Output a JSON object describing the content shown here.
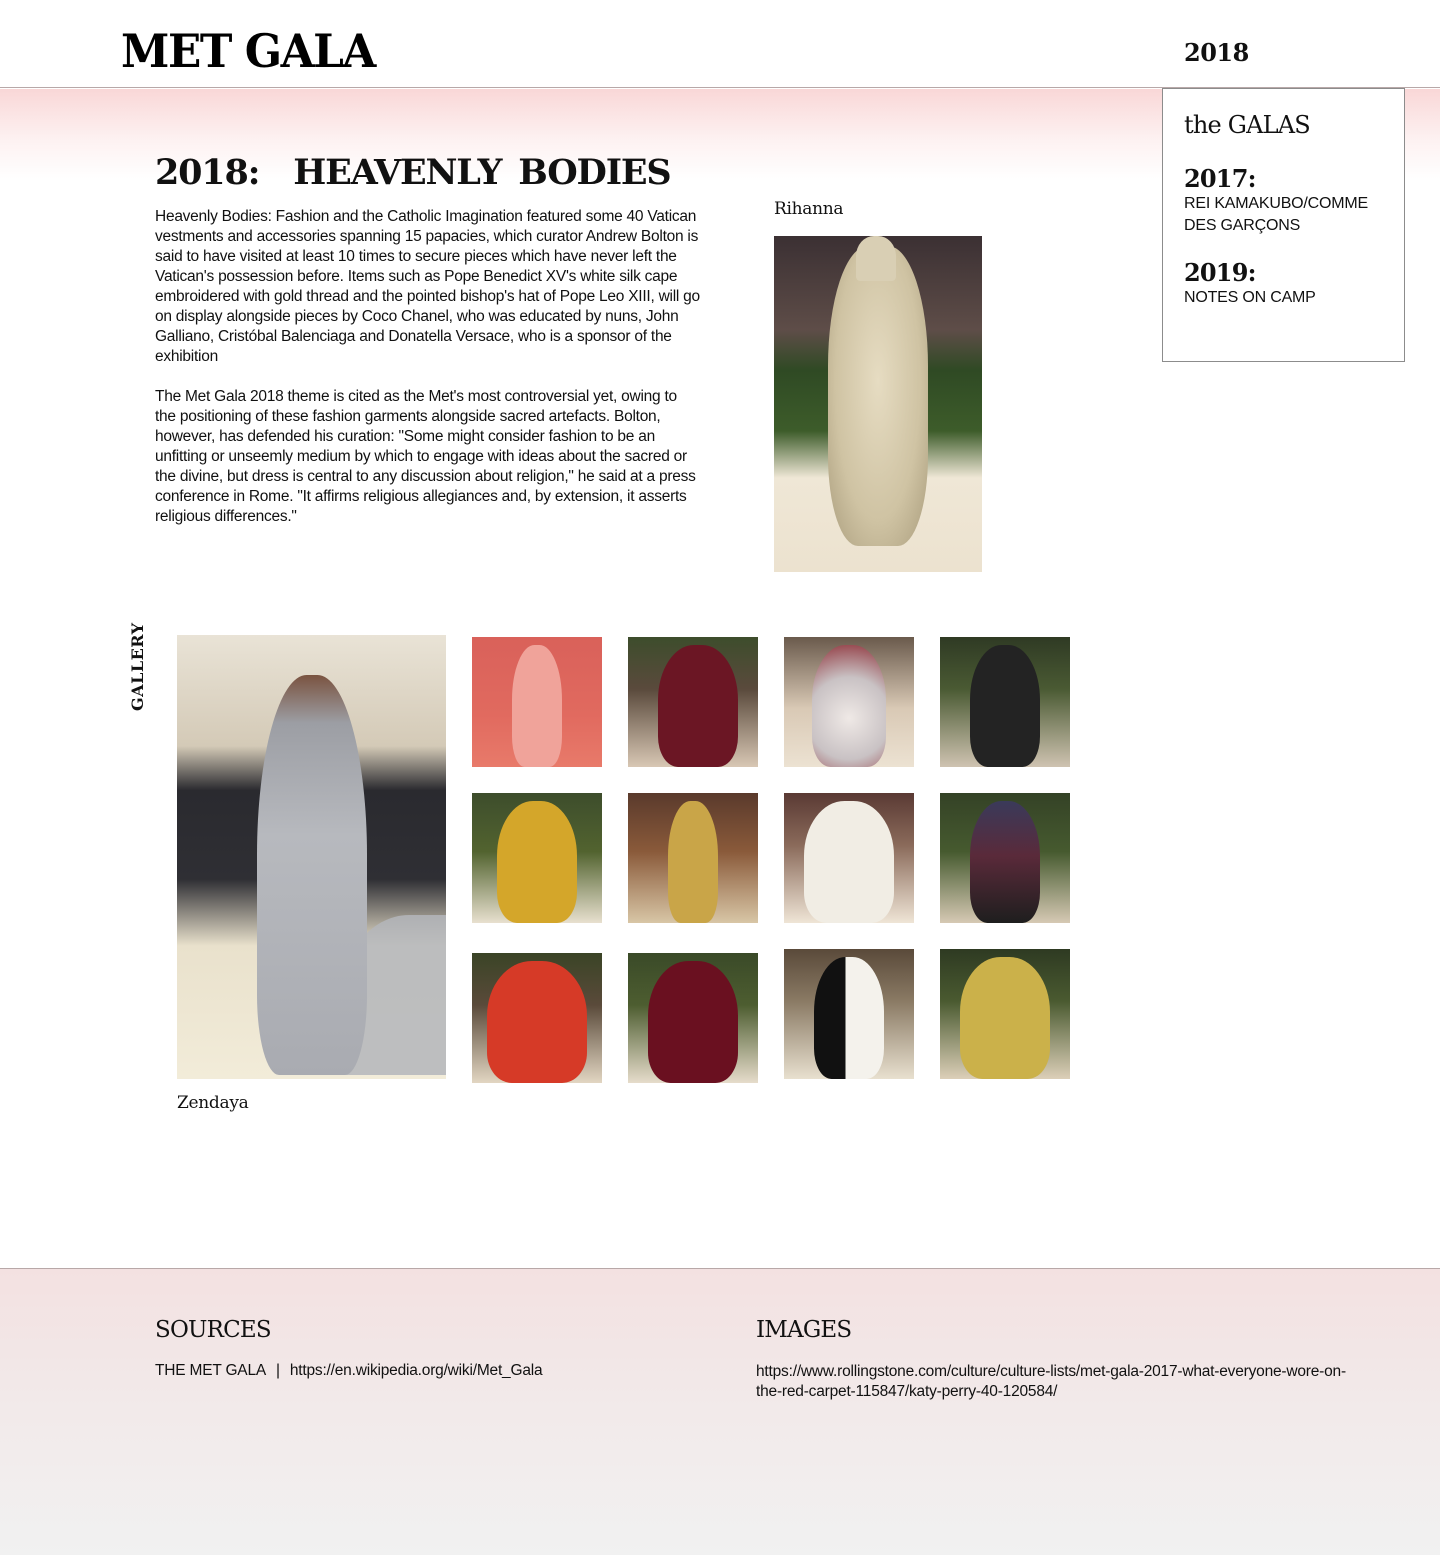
{
  "header": {
    "logo": "MET GALA",
    "year": "2018"
  },
  "galas": {
    "title": "the GALAS",
    "items": [
      {
        "year": "2017:",
        "name": "REI KAMAKUBO/COMME DES GARÇONS"
      },
      {
        "year": "2019:",
        "name": "NOTES ON CAMP"
      }
    ]
  },
  "main": {
    "title": "2018:  HEAVENLY BODIES",
    "paragraphs": [
      "Heavenly Bodies: Fashion and the Catholic Imagination featured some 40 Vatican vestments and accessories spanning 15 papacies, which curator Andrew Bolton is said to have visited at least 10 times to secure pieces which have never left the Vatican's possession before. Items such as Pope Benedict XV's white silk cape embroidered with gold thread and the pointed bishop's hat of Pope Leo XIII, will go on display alongside pieces by Coco Chanel, who was educated by nuns, John Galliano, Cristóbal Balenciaga and Donatella Versace, who is a sponsor of the exhibition",
      "The Met Gala 2018 theme is cited as the Met's most controversial yet, owing to the positioning of these fashion garments alongside sacred artefacts. Bolton, however, has defended his curation: \"Some might consider fashion to be an unfitting or unseemly medium by which to engage with ideas about the sacred or the divine, but dress is central to any discussion about religion,\" he said at a press conference in Rome. \"It affirms religious allegiances and, by extension, it asserts religious differences.\""
    ],
    "featured_caption": "Rihanna"
  },
  "gallery": {
    "label": "GALLERY",
    "featured_caption": "Zendaya"
  },
  "footer": {
    "sources_heading": "SOURCES",
    "sources_name": "THE MET GALA",
    "sources_separator": "|",
    "sources_url": "https://en.wikipedia.org/wiki/Met_Gala",
    "images_heading": "IMAGES",
    "images_url": "https://www.rollingstone.com/culture/culture-lists/met-gala-2017-what-everyone-wore-on-the-red-carpet-115847/katy-perry-40-120584/"
  },
  "colors": {
    "header_gradient_top": "#f9d7d7",
    "footer_gradient_top": "#f3e1e1",
    "footer_gradient_bottom": "#f1f1f1"
  }
}
